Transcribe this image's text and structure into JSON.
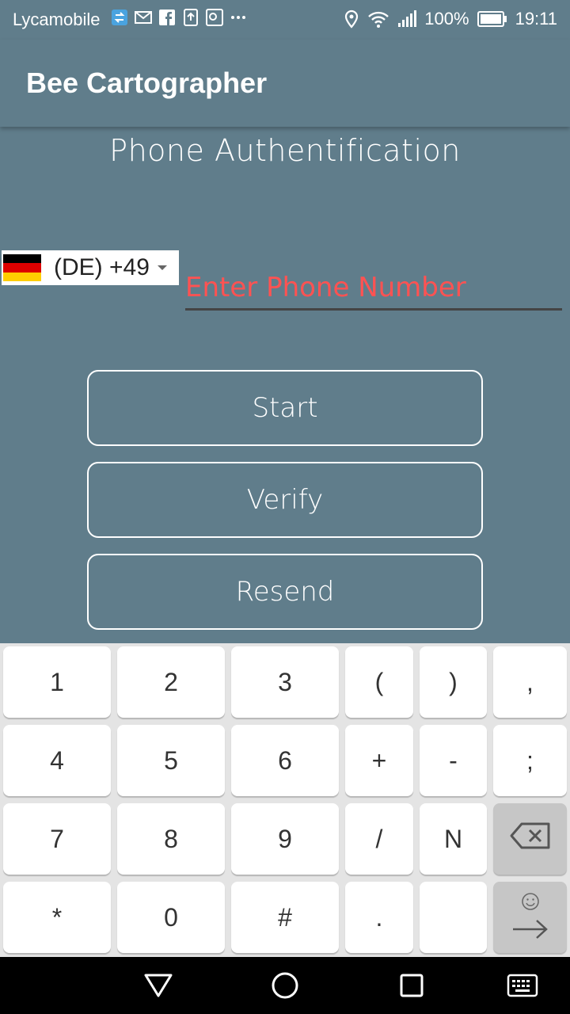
{
  "status_bar": {
    "carrier": "Lycamobile",
    "battery": "100%",
    "time": "19:11",
    "notification_icons": [
      "transfer-icon",
      "gmail-icon",
      "facebook-icon",
      "upload-icon",
      "maps-icon",
      "more-icon"
    ],
    "indicator_icons": [
      "location-icon",
      "wifi-icon",
      "signal-icon",
      "battery-icon"
    ]
  },
  "app_bar": {
    "title": "Bee Cartographer"
  },
  "page": {
    "title": "Phone Authentification"
  },
  "country_picker": {
    "flag": "germany-flag",
    "code": "(DE) +49"
  },
  "phone_input": {
    "placeholder": "Enter Phone Number",
    "value": ""
  },
  "buttons": {
    "start": "Start",
    "verify": "Verify",
    "resend": "Resend"
  },
  "keypad": {
    "rows": [
      [
        "1",
        "2",
        "3",
        "(",
        ")",
        ","
      ],
      [
        "4",
        "5",
        "6",
        "+",
        "-",
        ";"
      ],
      [
        "7",
        "8",
        "9",
        "/",
        "N",
        ""
      ],
      [
        "*",
        "0",
        "#",
        ".",
        "",
        ""
      ]
    ]
  },
  "colors": {
    "primary": "#607d8b",
    "placeholder_red": "#ff5252",
    "keyboard_bg": "#e4e4e4"
  }
}
